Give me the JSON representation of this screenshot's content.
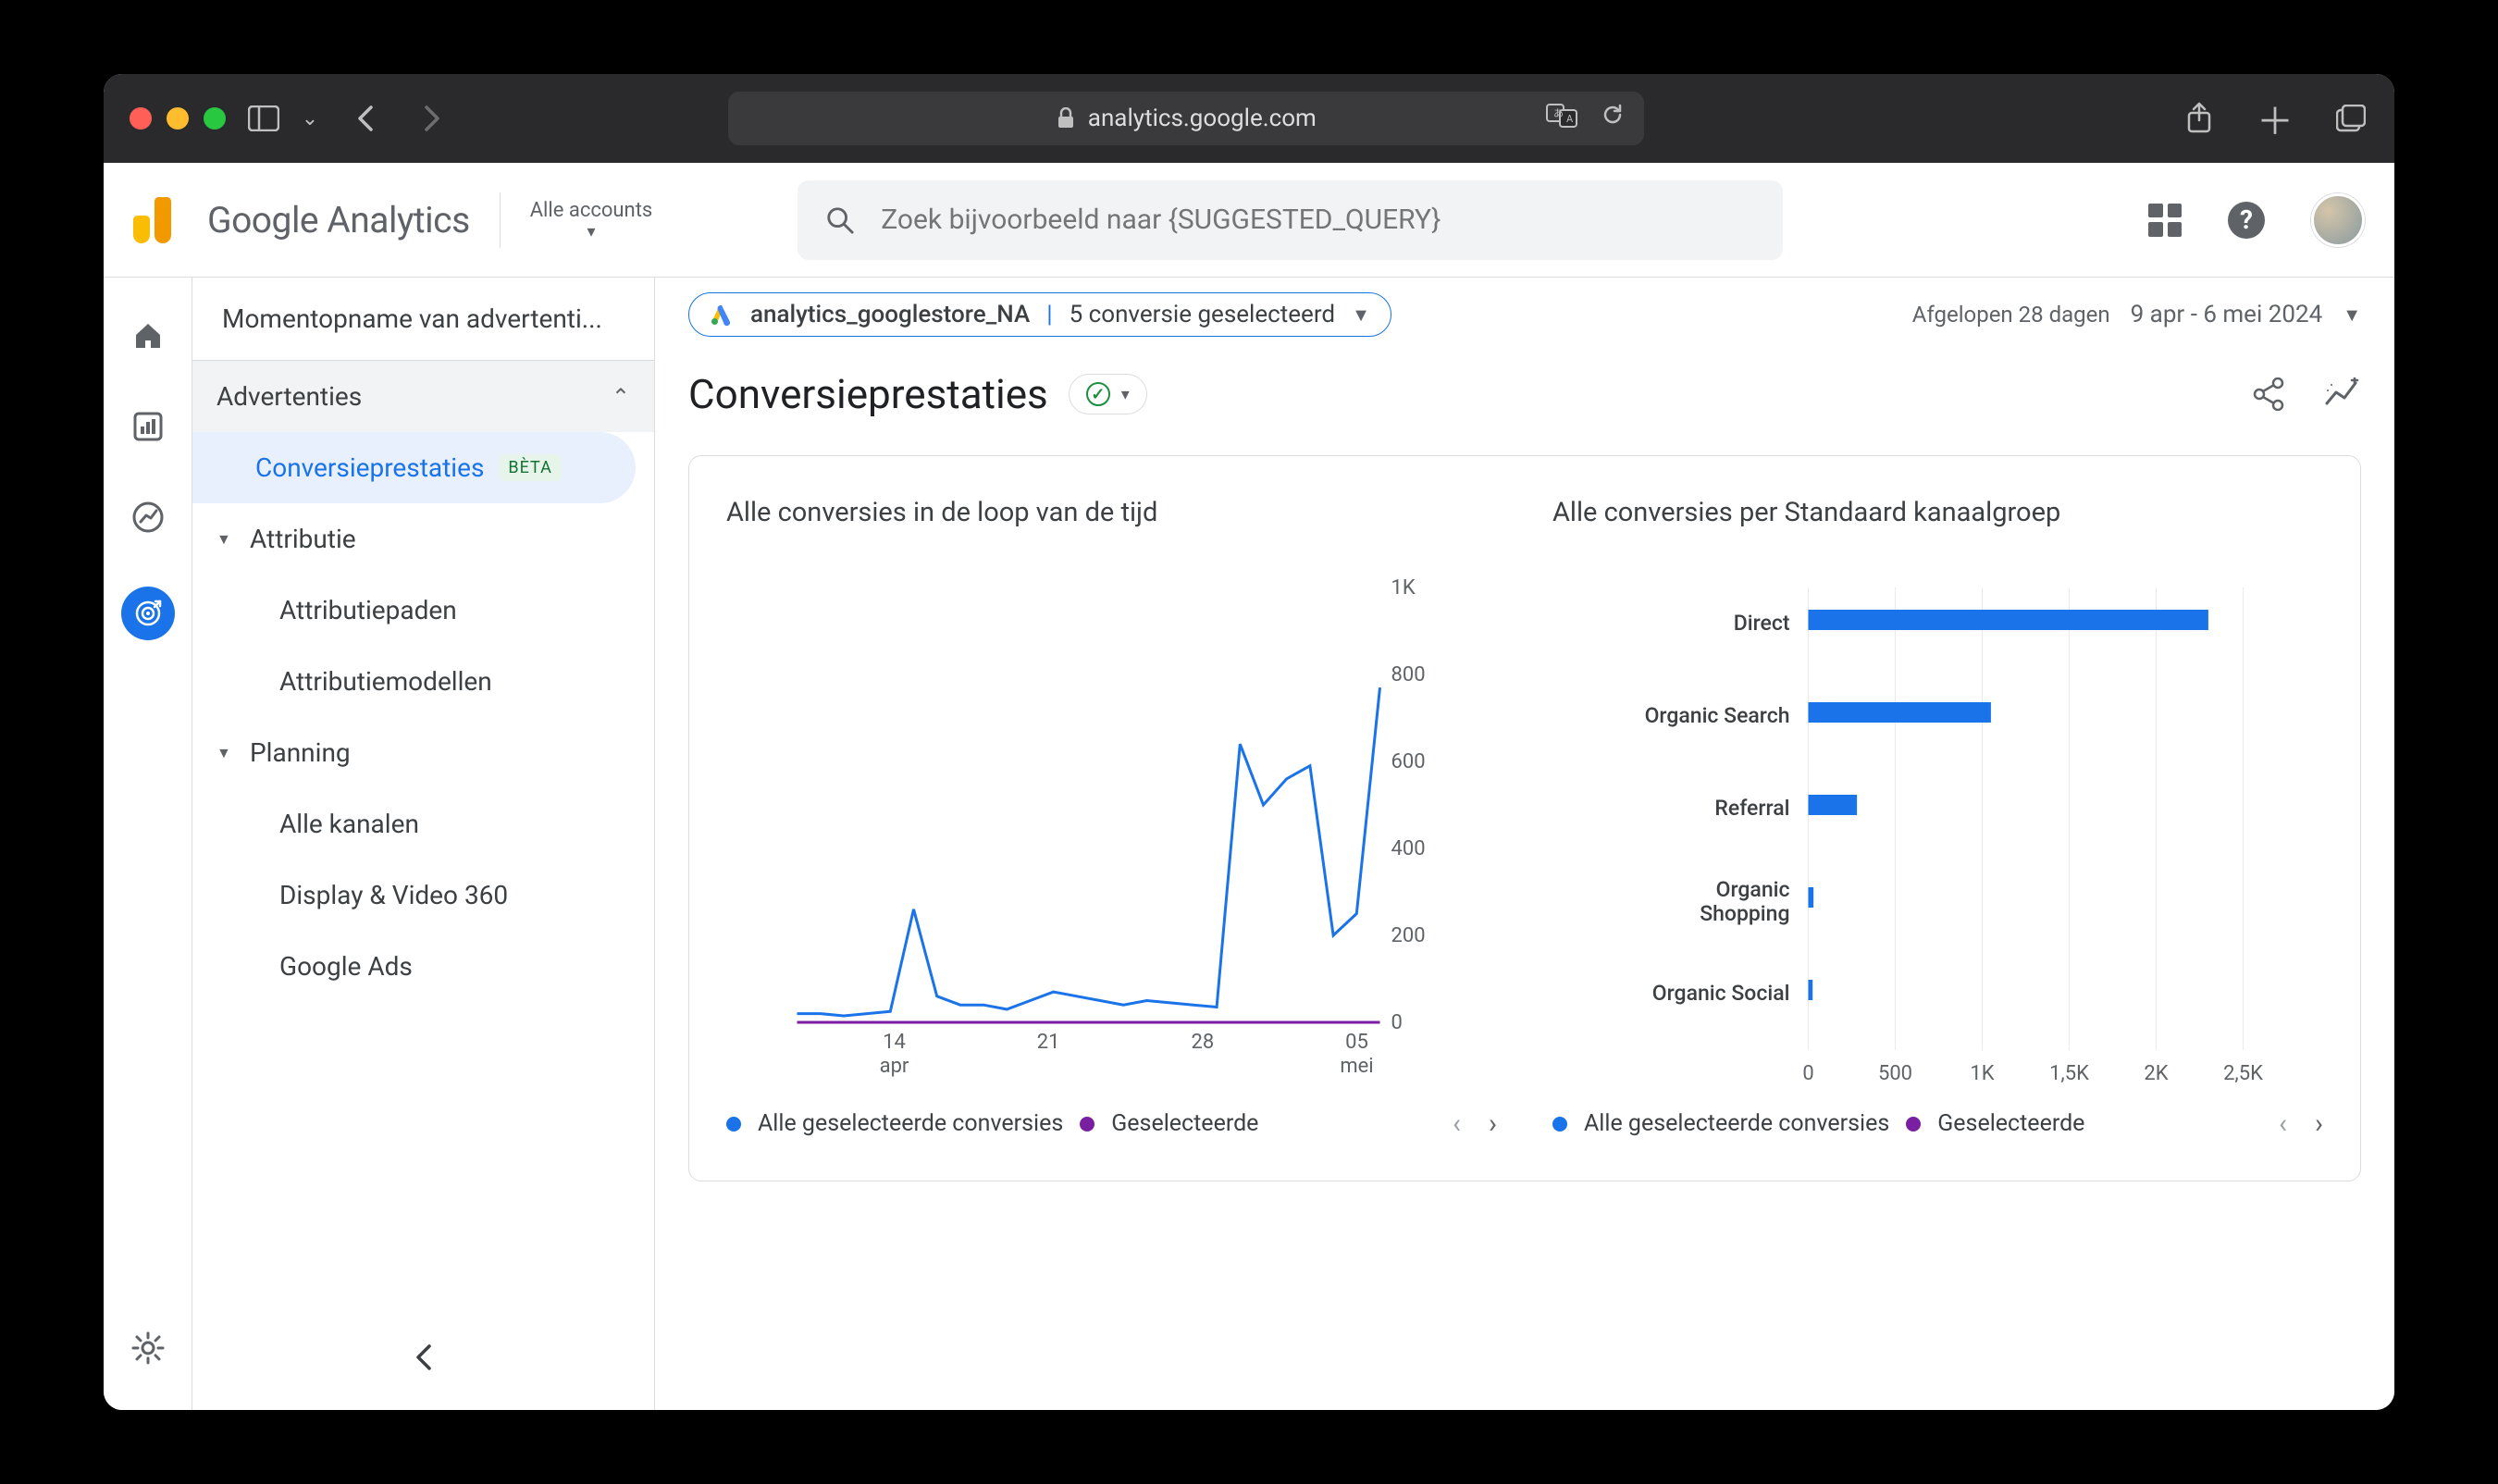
{
  "browser": {
    "url_host": "analytics.google.com"
  },
  "ga_header": {
    "product": "Google Analytics",
    "accounts_label": "Alle accounts",
    "search_placeholder": "Zoek bijvoorbeeld naar {SUGGESTED_QUERY}"
  },
  "sidebar": {
    "snapshot_label": "Momentopname van adverten­ti...",
    "section_head": "Advertenties",
    "items": {
      "conversieprestaties": "Conversieprestaties",
      "beta": "BÈTA",
      "attributie": "Attributie",
      "attributiepaden": "Attributiepaden",
      "attributiemodellen": "Attributiemodellen",
      "planning": "Planning",
      "alle_kanalen": "Alle kanalen",
      "display_video": "Display & Video 360",
      "google_ads": "Google Ads"
    }
  },
  "filters": {
    "property": "analytics_googlestore_NA",
    "conversions_selected": "5 conversie geselecteerd",
    "period_label": "Afgelopen 28 dagen",
    "date_range": "9 apr - 6 mei 2024"
  },
  "page": {
    "title": "Conversieprestaties"
  },
  "chart_data": [
    {
      "type": "line",
      "title": "Alle conversies in de loop van de tijd",
      "ylim": [
        0,
        1000
      ],
      "y_ticks": [
        "0",
        "200",
        "400",
        "600",
        "800",
        "1K"
      ],
      "x_categories": [
        {
          "label": "14",
          "sub": "apr"
        },
        {
          "label": "21",
          "sub": ""
        },
        {
          "label": "28",
          "sub": ""
        },
        {
          "label": "05",
          "sub": "mei"
        }
      ],
      "series": [
        {
          "name": "Alle geselecteerde conversies",
          "color": "#1a73e8",
          "values": [
            20,
            20,
            15,
            20,
            25,
            260,
            60,
            40,
            40,
            30,
            50,
            70,
            60,
            50,
            40,
            50,
            45,
            40,
            35,
            640,
            500,
            560,
            590,
            200,
            250,
            770
          ]
        },
        {
          "name": "Geselecteerde",
          "color": "#7b1fa2",
          "values": [
            0,
            0,
            0,
            0,
            0,
            0,
            0,
            0,
            0,
            0,
            0,
            0,
            0,
            0,
            0,
            0,
            0,
            0,
            0,
            0,
            0,
            0,
            0,
            0,
            0,
            0
          ]
        }
      ]
    },
    {
      "type": "bar",
      "orientation": "horizontal",
      "title": "Alle conversies per Standaard kanaalgroep",
      "xlim": [
        0,
        2500
      ],
      "x_ticks": [
        "0",
        "500",
        "1K",
        "1,5K",
        "2K",
        "2,5K"
      ],
      "categories": [
        "Direct",
        "Organic Search",
        "Referral",
        "Organic Shopping",
        "Organic Social"
      ],
      "series": [
        {
          "name": "Alle geselecteerde conversies",
          "color": "#1a73e8",
          "values": [
            2300,
            1050,
            280,
            30,
            25
          ]
        },
        {
          "name": "Geselecteerde",
          "color": "#7b1fa2",
          "values": [
            0,
            0,
            0,
            0,
            0
          ]
        }
      ]
    }
  ]
}
